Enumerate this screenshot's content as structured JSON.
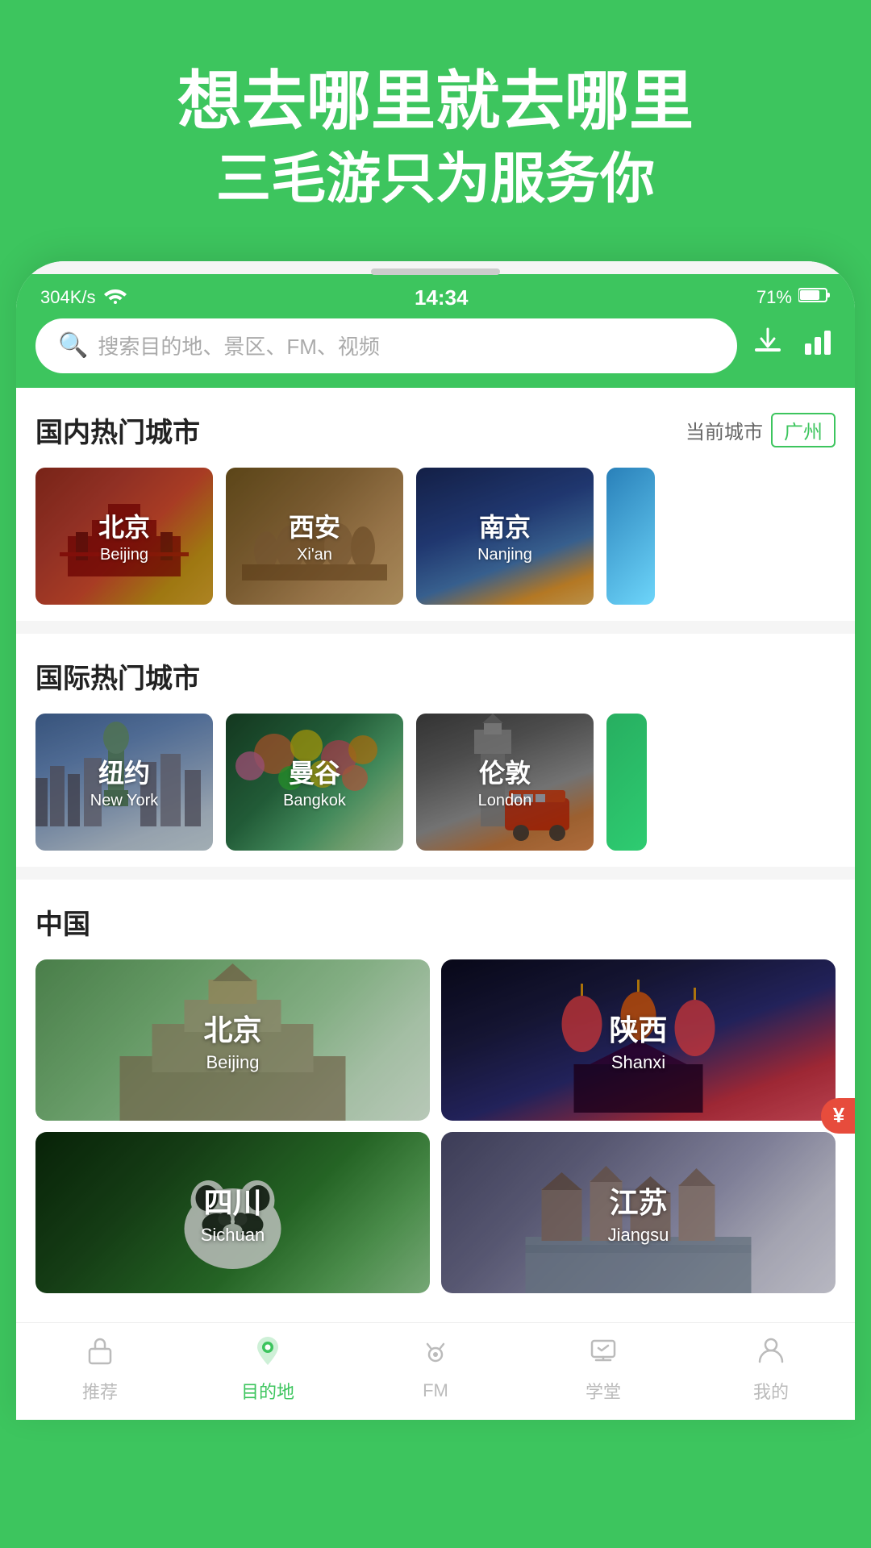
{
  "hero": {
    "title": "想去哪里就去哪里",
    "subtitle": "三毛游只为服务你"
  },
  "status_bar": {
    "left": "304K/s",
    "time": "14:34",
    "battery": "71%"
  },
  "search": {
    "placeholder": "搜索目的地、景区、FM、视频"
  },
  "domestic_section": {
    "title": "国内热门城市",
    "current_city_label": "当前城市",
    "current_city": "广州",
    "cities": [
      {
        "zh": "北京",
        "en": "Beijing",
        "bg": "bg-beijing"
      },
      {
        "zh": "西安",
        "en": "Xi'an",
        "bg": "bg-xian"
      },
      {
        "zh": "南京",
        "en": "Nanjing",
        "bg": "bg-nanjing"
      }
    ]
  },
  "international_section": {
    "title": "国际热门城市",
    "cities": [
      {
        "zh": "纽约",
        "en": "New York",
        "bg": "bg-newyork"
      },
      {
        "zh": "曼谷",
        "en": "Bangkok",
        "bg": "bg-bangkok"
      },
      {
        "zh": "伦敦",
        "en": "London",
        "bg": "bg-london"
      }
    ]
  },
  "china_section": {
    "title": "中国",
    "cities": [
      {
        "zh": "北京",
        "en": "Beijing",
        "bg": "bg-beijing2"
      },
      {
        "zh": "陕西",
        "en": "Shanxi",
        "bg": "bg-shaanxi"
      },
      {
        "zh": "四川",
        "en": "Sichuan",
        "bg": "bg-sichuan"
      },
      {
        "zh": "江苏",
        "en": "Jiangsu",
        "bg": "bg-jiangsu"
      }
    ]
  },
  "bottom_nav": {
    "items": [
      {
        "label": "推荐",
        "icon": "🏠",
        "active": false
      },
      {
        "label": "目的地",
        "icon": "📍",
        "active": true
      },
      {
        "label": "FM",
        "icon": "🎙",
        "active": false
      },
      {
        "label": "学堂",
        "icon": "📚",
        "active": false
      },
      {
        "label": "我的",
        "icon": "👤",
        "active": false
      }
    ]
  }
}
